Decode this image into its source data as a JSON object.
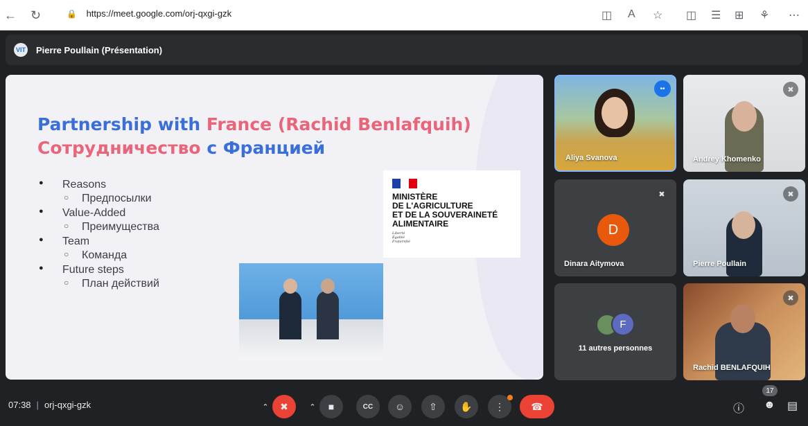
{
  "browser": {
    "url": "https://meet.google.com/orj-qxgi-gzk",
    "back_icon": "back-arrow-icon",
    "reload_icon": "reload-icon"
  },
  "presenter": {
    "avatar_text": "VIT",
    "name": "Pierre Poullain (Présentation)"
  },
  "slide": {
    "title_line1_part1": "Partnership with ",
    "title_line1_part2": "France (Rachid Benlafquih)",
    "title_line2_part1": "Сотрудничество ",
    "title_line2_part2": "с Францией",
    "bullets": [
      {
        "label": "Reasons",
        "sub": "Предпосылки"
      },
      {
        "label": "Value-Added",
        "sub": "Преимущества"
      },
      {
        "label": "Team",
        "sub": "Команда"
      },
      {
        "label": "Future steps",
        "sub": "План действий"
      }
    ],
    "ministry": {
      "line1": "MINISTÈRE",
      "line2": "DE L'AGRICULTURE",
      "line3": "ET DE LA SOUVERAINETÉ",
      "line4": "ALIMENTAIRE",
      "motto1": "Liberté",
      "motto2": "Égalité",
      "motto3": "Fraternité"
    }
  },
  "participants": [
    {
      "name": "Aliya Svanova",
      "muted": false
    },
    {
      "name": "Andrey Khomenko",
      "muted": true
    },
    {
      "name": "Dinara Aitymova",
      "initial": "D",
      "muted": true
    },
    {
      "name": "Pierre Poullain",
      "muted": true
    },
    {
      "name": "Rachid BENLAFQUIH",
      "muted": true
    }
  ],
  "others": {
    "initial": "F",
    "label": "11 autres personnes"
  },
  "bottom_bar": {
    "time": "07:38",
    "meeting_code": "orj-qxgi-gzk",
    "people_count": "17"
  },
  "colors": {
    "hangup": "#ea4335",
    "mic_off": "#ea4335",
    "title_blue": "#3b6fd8",
    "title_pink": "#e9657a",
    "avatar_d": "#e8590c",
    "avatar_f": "#5c6bc0"
  }
}
